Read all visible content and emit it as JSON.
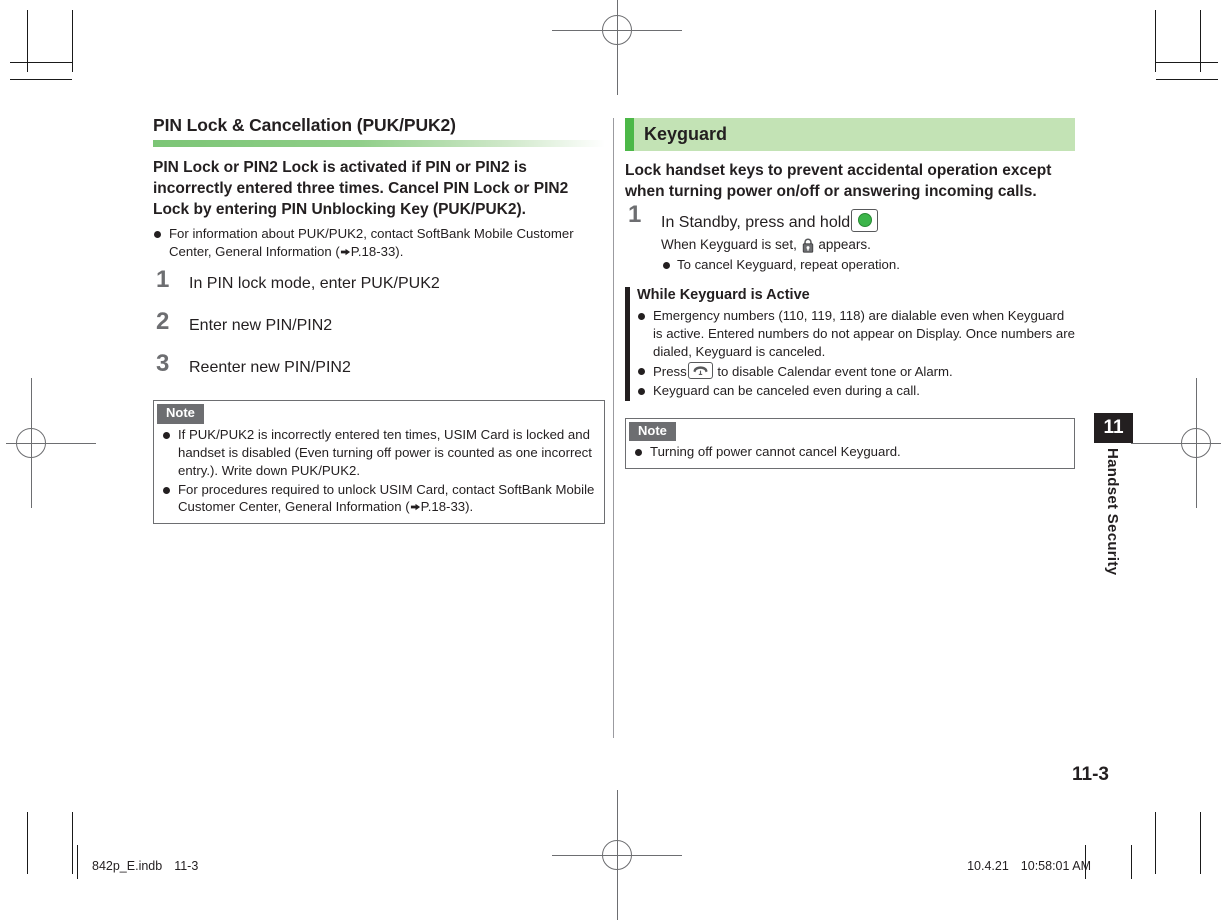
{
  "left_column": {
    "section_title": "PIN Lock & Cancellation (PUK/PUK2)",
    "lead": "PIN Lock or PIN2 Lock is activated if PIN or PIN2 is incorrectly entered three times. Cancel PIN Lock or PIN2 Lock by entering PIN Unblocking Key (PUK/PUK2).",
    "bullet": {
      "text_before_ref": "For information about PUK/PUK2, contact SoftBank Mobile Customer Center, General Information (",
      "ref": "P.18-33",
      "text_after_ref": ")."
    },
    "steps": [
      {
        "number": "1",
        "text": "In PIN lock mode, enter PUK/PUK2"
      },
      {
        "number": "2",
        "text": "Enter new PIN/PIN2"
      },
      {
        "number": "3",
        "text": "Reenter new PIN/PIN2"
      }
    ],
    "note": {
      "tag": "Note",
      "items": [
        {
          "text": "If PUK/PUK2 is incorrectly entered ten times, USIM Card is locked and handset is disabled (Even turning off power is counted as one incorrect entry.). Write down PUK/PUK2."
        },
        {
          "text_before_ref": "For procedures required to unlock USIM Card, contact SoftBank Mobile Customer Center, General Information (",
          "ref": "P.18-33",
          "text_after_ref": ")."
        }
      ]
    }
  },
  "right_column": {
    "header_title": "Keyguard",
    "header_accent_color": "#4cb848",
    "header_background_color": "#c3e3b5",
    "lead": "Lock handset keys to prevent accidental operation except when turning power on/off or answering incoming calls.",
    "step": {
      "number": "1",
      "text": "In Standby, press and hold",
      "key_icon": "center-key-icon",
      "sub_text_before_icon": "When Keyguard is set,",
      "sub_icon": "lock-icon",
      "sub_text_after_icon": "appears.",
      "sub_bullet": "To cancel Keyguard, repeat operation."
    },
    "active_block": {
      "title": "While Keyguard is Active",
      "items": [
        {
          "text": "Emergency numbers (110, 119, 118) are dialable even when Keyguard is active. Entered numbers do not appear on Display. Once numbers are dialed, Keyguard is canceled."
        },
        {
          "text_before_icon": "Press",
          "icon": "end-call-key-icon",
          "text_after_icon": "to disable Calendar event tone or Alarm."
        },
        {
          "text": "Keyguard can be canceled even during a call."
        }
      ]
    },
    "note": {
      "tag": "Note",
      "items": [
        {
          "text": "Turning off power cannot cancel Keyguard."
        }
      ]
    }
  },
  "chapter": {
    "number": "11",
    "label": "Handset Security"
  },
  "page_number": "11-3",
  "footer": {
    "file_name": "842p_E.indb",
    "page_ref": "11-3",
    "date": "10.4.21",
    "time": "10:58:01 AM"
  }
}
